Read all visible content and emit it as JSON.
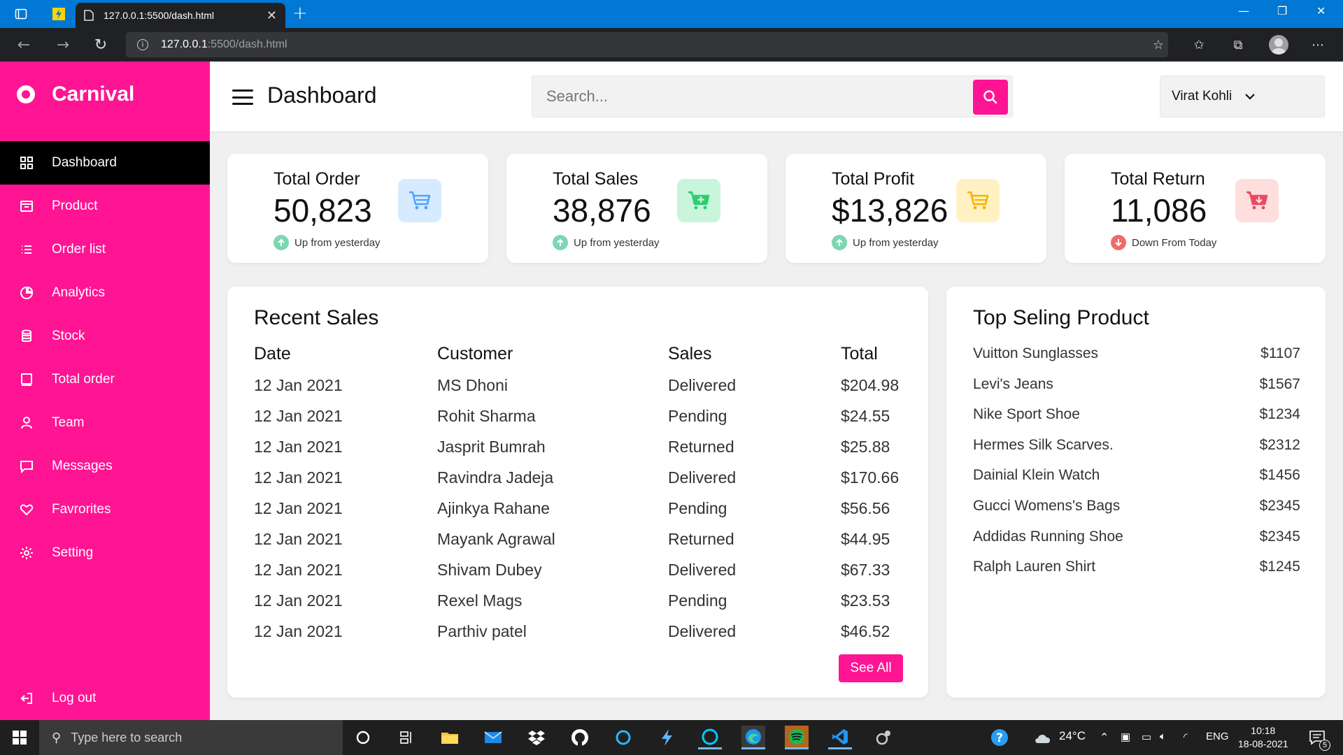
{
  "browser": {
    "tab_title": "127.0.0.1:5500/dash.html",
    "url_host": "127.0.0.1",
    "url_path": ":5500/dash.html"
  },
  "sidebar": {
    "brand": "Carnival",
    "items": [
      {
        "label": "Dashboard",
        "icon": "grid-icon",
        "active": true
      },
      {
        "label": "Product",
        "icon": "box-icon"
      },
      {
        "label": "Order list",
        "icon": "list-icon"
      },
      {
        "label": "Analytics",
        "icon": "pie-chart-icon"
      },
      {
        "label": "Stock",
        "icon": "database-icon"
      },
      {
        "label": "Total order",
        "icon": "tablet-icon"
      },
      {
        "label": "Team",
        "icon": "user-icon"
      },
      {
        "label": "Messages",
        "icon": "message-icon"
      },
      {
        "label": "Favrorites",
        "icon": "heart-icon"
      },
      {
        "label": "Setting",
        "icon": "gear-icon"
      }
    ],
    "logout": "Log out"
  },
  "header": {
    "title": "Dashboard",
    "search_placeholder": "Search...",
    "user_name": "Virat Kohli"
  },
  "stats": [
    {
      "label": "Total Order",
      "value": "50,823",
      "trend": "Up from yesterday",
      "direction": "up",
      "icon_bg": "#d6ebff",
      "icon_color": "#4da3ff"
    },
    {
      "label": "Total Sales",
      "value": "38,876",
      "trend": "Up from yesterday",
      "direction": "up",
      "icon_bg": "#c8f5dc",
      "icon_color": "#2ecc71"
    },
    {
      "label": "Total Profit",
      "value": "$13,826",
      "trend": "Up from yesterday",
      "direction": "up",
      "icon_bg": "#fff1c2",
      "icon_color": "#f5b301"
    },
    {
      "label": "Total Return",
      "value": "11,086",
      "trend": "Down From Today",
      "direction": "down",
      "icon_bg": "#ffdede",
      "icon_color": "#e84a5f"
    }
  ],
  "recent_sales": {
    "title": "Recent Sales",
    "columns": [
      "Date",
      "Customer",
      "Sales",
      "Total"
    ],
    "rows": [
      [
        "12 Jan 2021",
        "MS Dhoni",
        "Delivered",
        "$204.98"
      ],
      [
        "12 Jan 2021",
        "Rohit Sharma",
        "Pending",
        "$24.55"
      ],
      [
        "12 Jan 2021",
        "Jasprit Bumrah",
        "Returned",
        "$25.88"
      ],
      [
        "12 Jan 2021",
        "Ravindra Jadeja",
        "Delivered",
        "$170.66"
      ],
      [
        "12 Jan 2021",
        "Ajinkya Rahane",
        "Pending",
        "$56.56"
      ],
      [
        "12 Jan 2021",
        "Mayank Agrawal",
        "Returned",
        "$44.95"
      ],
      [
        "12 Jan 2021",
        "Shivam Dubey",
        "Delivered",
        "$67.33"
      ],
      [
        "12 Jan 2021",
        "Rexel Mags",
        "Pending",
        "$23.53"
      ],
      [
        "12 Jan 2021",
        "Parthiv patel",
        "Delivered",
        "$46.52"
      ]
    ],
    "see_all": "See All"
  },
  "top_selling": {
    "title": "Top Seling Product",
    "items": [
      {
        "name": "Vuitton Sunglasses",
        "price": "$1107"
      },
      {
        "name": "Levi's Jeans",
        "price": "$1567"
      },
      {
        "name": "Nike Sport Shoe",
        "price": "$1234"
      },
      {
        "name": "Hermes Silk Scarves.",
        "price": "$2312"
      },
      {
        "name": "Dainial Klein Watch",
        "price": "$1456"
      },
      {
        "name": "Gucci Womens's Bags",
        "price": "$2345"
      },
      {
        "name": "Addidas Running Shoe",
        "price": "$2345"
      },
      {
        "name": "Ralph Lauren Shirt",
        "price": "$1245"
      }
    ]
  },
  "taskbar": {
    "search_placeholder": "Type here to search",
    "weather": "24°C",
    "language": "ENG",
    "time": "10:18",
    "date": "18-08-2021",
    "notification_count": "5"
  },
  "colors": {
    "accent": "#ff1493",
    "sidebar_active": "#000000",
    "browser_blue": "#0078d4"
  }
}
